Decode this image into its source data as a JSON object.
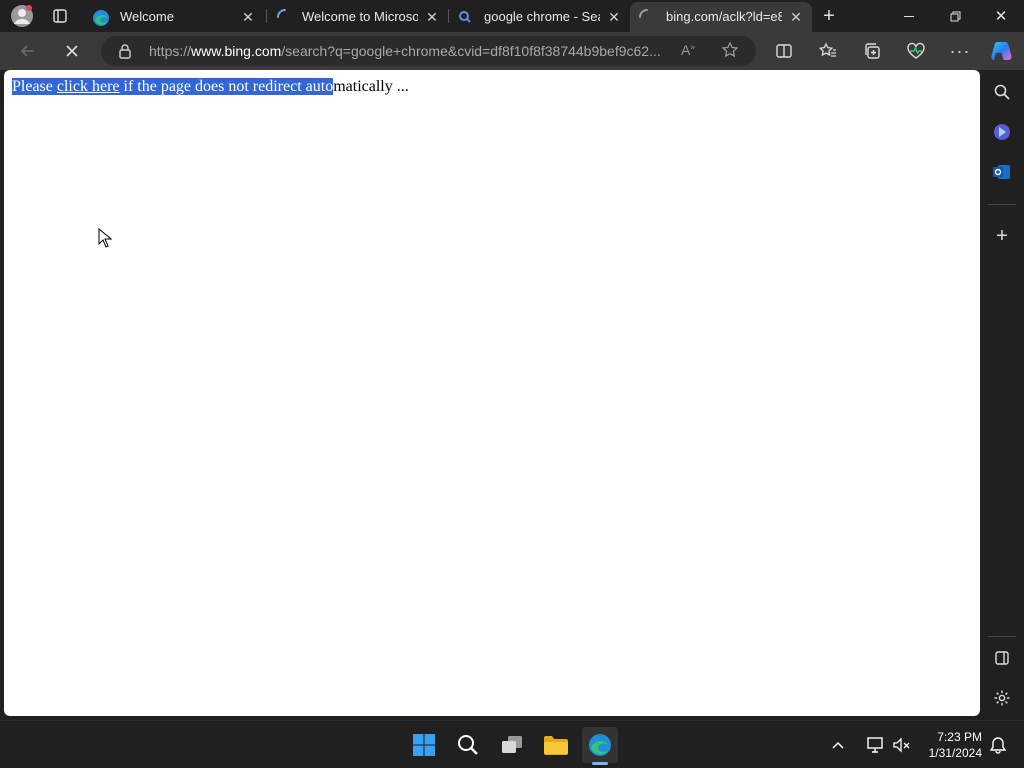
{
  "tabs": [
    {
      "label": "Welcome"
    },
    {
      "label": "Welcome to Microsoft"
    },
    {
      "label": "google chrome - Sear"
    },
    {
      "label": "bing.com/aclk?ld=e8"
    }
  ],
  "address": {
    "prefix": "https://",
    "host": "www.bing.com",
    "path": "/search?q=google+chrome&cvid=df8f10f8f38744b9bef9c62..."
  },
  "page": {
    "selected_before_link": "Please ",
    "link_text": "click here",
    "selected_after_link": " if the page does not redirect auto",
    "rest": "matically ..."
  },
  "clock": {
    "time": "7:23 PM",
    "date": "1/31/2024"
  },
  "colors": {
    "selection": "#3367d6",
    "chrome_bg": "#202020",
    "toolbar_bg": "#3a3a3a"
  }
}
